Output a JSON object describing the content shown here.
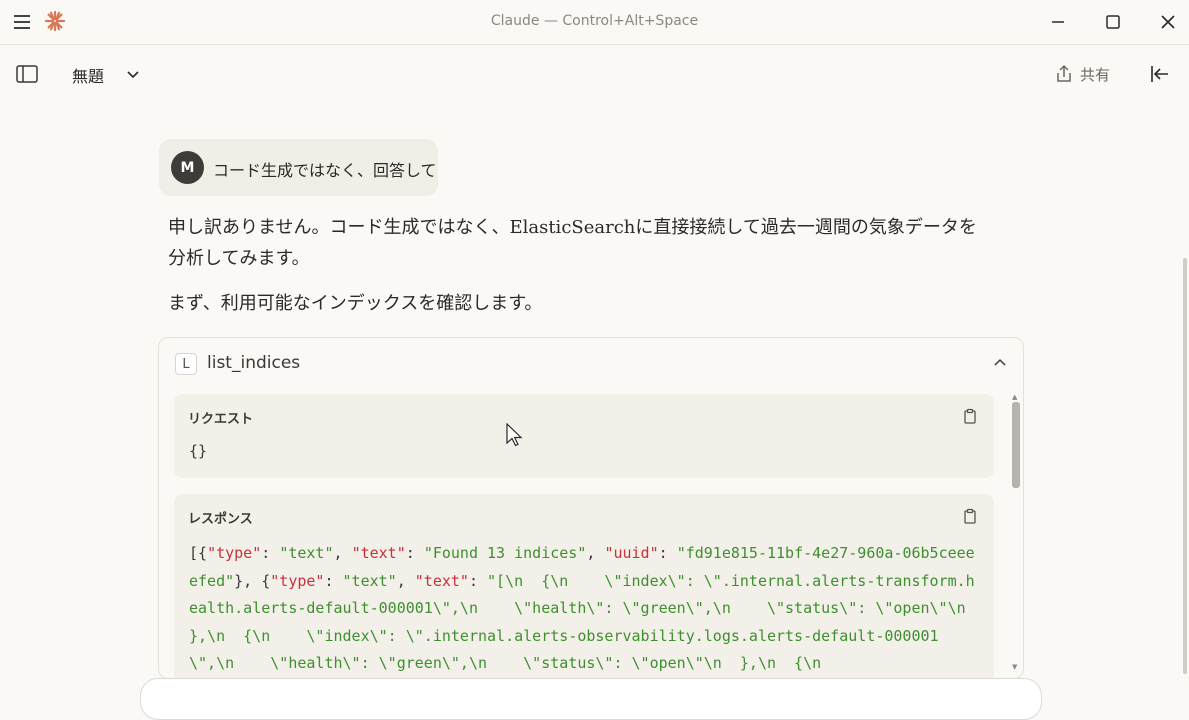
{
  "window": {
    "title": "Claude — Control+Alt+Space",
    "menu_icon": "hamburger-icon",
    "logo_icon": "claude-logo",
    "controls": [
      "minimize-icon",
      "maximize-icon",
      "close-icon"
    ]
  },
  "header": {
    "conversation_title": "無題",
    "share_label": "共有"
  },
  "colors": {
    "background": "#faf9f5",
    "user_bubble": "#f0eee6",
    "logo": "#d97757",
    "json_key": "#c9303a",
    "json_string": "#3f8f2f"
  },
  "conversation": {
    "user_message": {
      "avatar_initial": "M",
      "text": "コード生成ではなく、回答して"
    },
    "assistant": {
      "paragraph1": "申し訳ありません。コード生成ではなく、ElasticSearchに直接接続して過去一週間の気象データを分析してみます。",
      "paragraph2": "まず、利用可能なインデックスを確認します。"
    },
    "tool_call": {
      "badge": "L",
      "name": "list_indices",
      "request_label": "リクエスト",
      "request_body": "{}",
      "response_label": "レスポンス",
      "response_tokens": [
        {
          "t": "[{",
          "c": "pun"
        },
        {
          "t": "\"type\"",
          "c": "key"
        },
        {
          "t": ": ",
          "c": "pun"
        },
        {
          "t": "\"text\"",
          "c": "str"
        },
        {
          "t": ", ",
          "c": "pun"
        },
        {
          "t": "\"text\"",
          "c": "key"
        },
        {
          "t": ": ",
          "c": "pun"
        },
        {
          "t": "\"Found 13 indices\"",
          "c": "str"
        },
        {
          "t": ", ",
          "c": "pun"
        },
        {
          "t": "\"uuid\"",
          "c": "key"
        },
        {
          "t": ": ",
          "c": "pun"
        },
        {
          "t": "\"fd91e815-11bf-4e27-960a-06b5ceeeefed\"",
          "c": "str"
        },
        {
          "t": "}, {",
          "c": "pun"
        },
        {
          "t": "\"type\"",
          "c": "key"
        },
        {
          "t": ": ",
          "c": "pun"
        },
        {
          "t": "\"text\"",
          "c": "str"
        },
        {
          "t": ", ",
          "c": "pun"
        },
        {
          "t": "\"text\"",
          "c": "key"
        },
        {
          "t": ": ",
          "c": "pun"
        },
        {
          "t": "\"[\\n  {\\n    \\\"index\\\": \\\".internal.alerts-transform.health.alerts-default-000001\\\",\\n    \\\"health\\\": \\\"green\\\",\\n    \\\"status\\\": \\\"open\\\"\\n  },\\n  {\\n    \\\"index\\\": \\\".internal.alerts-observability.logs.alerts-default-000001\\\",\\n    \\\"health\\\": \\\"green\\\",\\n    \\\"status\\\": \\\"open\\\"\\n  },\\n  {\\n",
          "c": "str"
        }
      ]
    }
  }
}
